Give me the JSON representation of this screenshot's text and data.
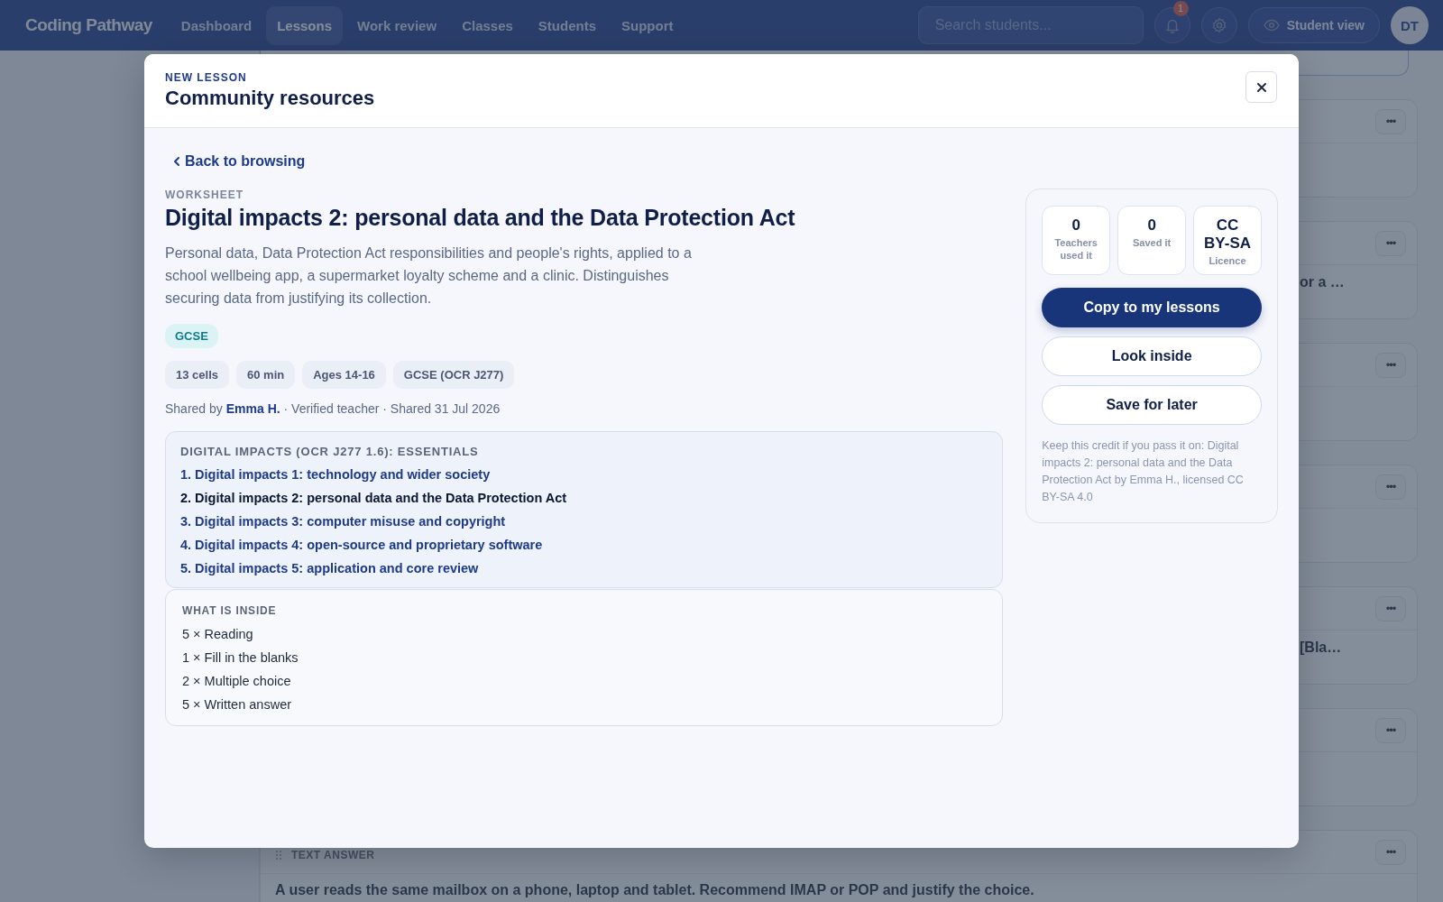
{
  "nav": {
    "brand": "Coding Pathway",
    "items": [
      {
        "label": "Dashboard",
        "selected": false
      },
      {
        "label": "Lessons",
        "selected": true
      },
      {
        "label": "Work review",
        "selected": false
      },
      {
        "label": "Classes",
        "selected": false
      },
      {
        "label": "Students",
        "selected": false
      },
      {
        "label": "Support",
        "selected": false
      }
    ],
    "search": {
      "placeholder": "Search students..."
    },
    "notification_count": "1",
    "student_view": "Student view",
    "avatar": "DT"
  },
  "background": {
    "cards": [
      {
        "menu": "•••"
      },
      {
        "menu": "•••",
        "snippet": "or a …"
      },
      {
        "menu": "•••"
      },
      {
        "menu": "•••"
      },
      {
        "menu": "•••",
        "snippet": "[Bla…"
      },
      {
        "menu": "•••"
      },
      {
        "menu": "•••",
        "label": "TEXT ANSWER",
        "snippet": "A user reads the same mailbox on a phone, laptop and tablet. Recommend IMAP or POP and justify the choice."
      }
    ]
  },
  "modal": {
    "eyebrow": "NEW LESSON",
    "title": "Community resources",
    "back_link": "Back to browsing",
    "resource": {
      "type": "WORKSHEET",
      "title": "Digital impacts 2: personal data and the Data Protection Act",
      "description": "Personal data, Data Protection Act responsibilities and people's rights, applied to a school wellbeing app, a supermarket loyalty scheme and a clinic. Distinguishes securing data from justifying its collection.",
      "level_tag": "GCSE",
      "chips": [
        "13 cells",
        "60 min",
        "Ages 14-16",
        "GCSE (OCR J277)"
      ],
      "shared_prefix": "Shared by",
      "author": "Emma H.",
      "shared_suffix": "· Verified teacher · Shared 31 Jul 2026"
    },
    "series": {
      "title": "DIGITAL IMPACTS (OCR J277 1.6): ESSENTIALS",
      "lessons": [
        {
          "label": "1. Digital impacts 1: technology and wider society",
          "current": false
        },
        {
          "label": "2. Digital impacts 2: personal data and the Data Protection Act",
          "current": true
        },
        {
          "label": "3. Digital impacts 3: computer misuse and copyright",
          "current": false
        },
        {
          "label": "4. Digital impacts 4: open-source and proprietary software",
          "current": false
        },
        {
          "label": "5. Digital impacts 5: application and core review",
          "current": false
        }
      ]
    },
    "contents": {
      "title": "WHAT IS INSIDE",
      "items": [
        "5 × Reading",
        "1 × Fill in the blanks",
        "2 × Multiple choice",
        "5 × Written answer"
      ]
    },
    "stats": [
      {
        "value": "0",
        "label": "Teachers used it"
      },
      {
        "value": "0",
        "label": "Saved it"
      },
      {
        "value": "CC BY-SA",
        "label": "Licence"
      }
    ],
    "actions": [
      {
        "label": "Copy to my lessons",
        "kind": "primary"
      },
      {
        "label": "Look inside",
        "kind": "secondary"
      },
      {
        "label": "Save for later",
        "kind": "secondary"
      }
    ],
    "credit": "Keep this credit if you pass it on: Digital impacts 2: personal data and the Data Protection Act by Emma H., licensed CC BY-SA 4.0"
  }
}
